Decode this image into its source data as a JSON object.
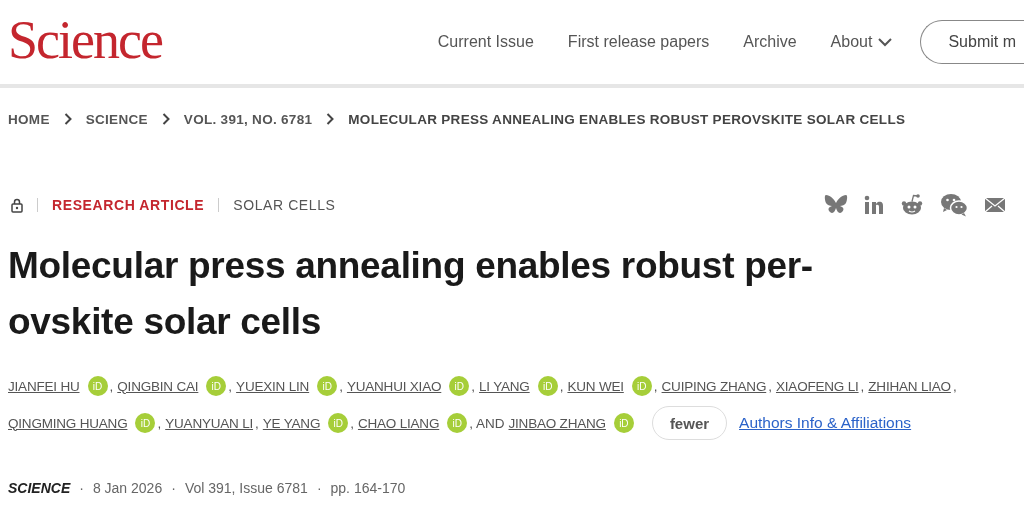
{
  "header": {
    "logo": "Science",
    "nav": [
      {
        "label": "Current Issue",
        "dropdown": false
      },
      {
        "label": "First release papers",
        "dropdown": false
      },
      {
        "label": "Archive",
        "dropdown": false
      },
      {
        "label": "About",
        "dropdown": true
      }
    ],
    "submit_button": "Submit m"
  },
  "breadcrumbs": [
    "HOME",
    "SCIENCE",
    "VOL. 391, NO. 6781",
    "MOLECULAR PRESS ANNEALING ENABLES ROBUST PEROVSKITE SOLAR CELLS"
  ],
  "article": {
    "locked": true,
    "type": "RESEARCH ARTICLE",
    "section": "SOLAR CELLS",
    "share": [
      {
        "kind": "bluesky"
      },
      {
        "kind": "linkedin"
      },
      {
        "kind": "reddit"
      },
      {
        "kind": "wechat"
      },
      {
        "kind": "email"
      }
    ],
    "title_lines": [
      "Molecular press annealing enables robust per-",
      "ovskite solar cells"
    ],
    "authors": [
      {
        "name": "JIANFEI HU",
        "orcid": "iD",
        "after": ","
      },
      {
        "name": "QINGBIN CAI",
        "orcid": "iD",
        "after": ","
      },
      {
        "name": "YUEXIN LIN",
        "orcid": "iD",
        "after": ","
      },
      {
        "name": "YUANHUI XIAO",
        "orcid": "iD",
        "after": ","
      },
      {
        "name": "LI YANG",
        "orcid": "iD",
        "after": ","
      },
      {
        "name": "KUN WEI",
        "orcid": "iD",
        "after": ","
      },
      {
        "name": "CUIPING ZHANG",
        "after": ","
      },
      {
        "name": "XIAOFENG LI",
        "after": ","
      },
      {
        "name": "ZHIHAN LIAO",
        "after": ","
      },
      {
        "name": "QINGMING HUANG",
        "orcid": "iD",
        "after": ","
      },
      {
        "name": "YUANYUAN LI",
        "after": ","
      },
      {
        "name": "YE YANG",
        "orcid": "iD",
        "after": ","
      },
      {
        "name": "CHAO LIANG",
        "orcid": "iD",
        "after": ", AND"
      },
      {
        "name": "JINBAO ZHANG",
        "orcid": "iD"
      }
    ],
    "fewer_button": "fewer",
    "affiliations_link": "Authors Info & Affiliations",
    "pub_line": [
      "SCIENCE",
      "·",
      "8 Jan 2026",
      "·",
      "Vol 391, Issue 6781",
      "·",
      "pp. 164-170"
    ]
  }
}
